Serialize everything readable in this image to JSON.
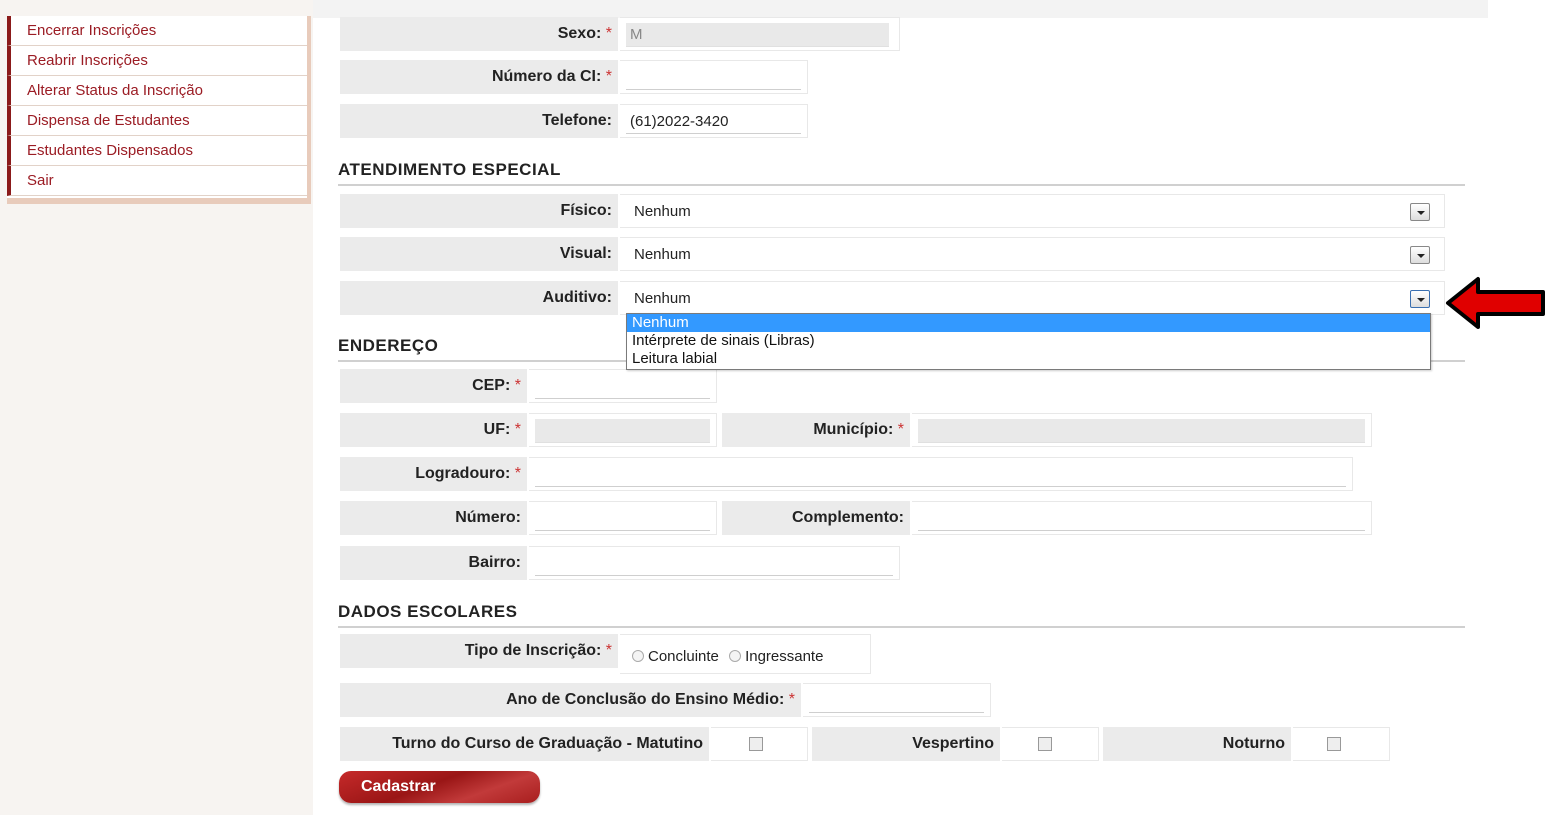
{
  "menu": {
    "items": [
      {
        "label": "Encerrar Inscrições"
      },
      {
        "label": "Reabrir Inscrições"
      },
      {
        "label": "Alterar Status da Inscrição"
      },
      {
        "label": "Dispensa de Estudantes"
      },
      {
        "label": "Estudantes Dispensados"
      },
      {
        "label": "Sair"
      }
    ]
  },
  "required_mark": "*",
  "personal": {
    "sexo_label": "Sexo:",
    "sexo_value": "M",
    "ci_label": "Número da CI:",
    "ci_value": "",
    "telefone_label": "Telefone:",
    "telefone_value": "(61)2022-3420"
  },
  "atendimento": {
    "title": "ATENDIMENTO ESPECIAL",
    "fisico_label": "Físico:",
    "fisico_value": "Nenhum",
    "visual_label": "Visual:",
    "visual_value": "Nenhum",
    "auditivo_label": "Auditivo:",
    "auditivo_value": "Nenhum",
    "auditivo_options": [
      "Nenhum",
      "Intérprete de sinais (Libras)",
      "Leitura labial"
    ]
  },
  "endereco": {
    "title": "ENDEREÇO",
    "cep_label": "CEP:",
    "uf_label": "UF:",
    "municipio_label": "Município:",
    "logradouro_label": "Logradouro:",
    "numero_label": "Número:",
    "complemento_label": "Complemento:",
    "bairro_label": "Bairro:"
  },
  "escolares": {
    "title": "DADOS ESCOLARES",
    "tipo_label": "Tipo de Inscrição:",
    "opt_concluinte": "Concluinte",
    "opt_ingressante": "Ingressante",
    "ano_label": "Ano de Conclusão do Ensino Médio:",
    "turno_label": "Turno do Curso de Graduação - Matutino",
    "vespertino_label": "Vespertino",
    "noturno_label": "Noturno"
  },
  "submit_label": "Cadastrar",
  "colors": {
    "accent": "#9b1c24",
    "button": "#a81e1e",
    "selection": "#3399ff",
    "arrow": "#e00000"
  }
}
